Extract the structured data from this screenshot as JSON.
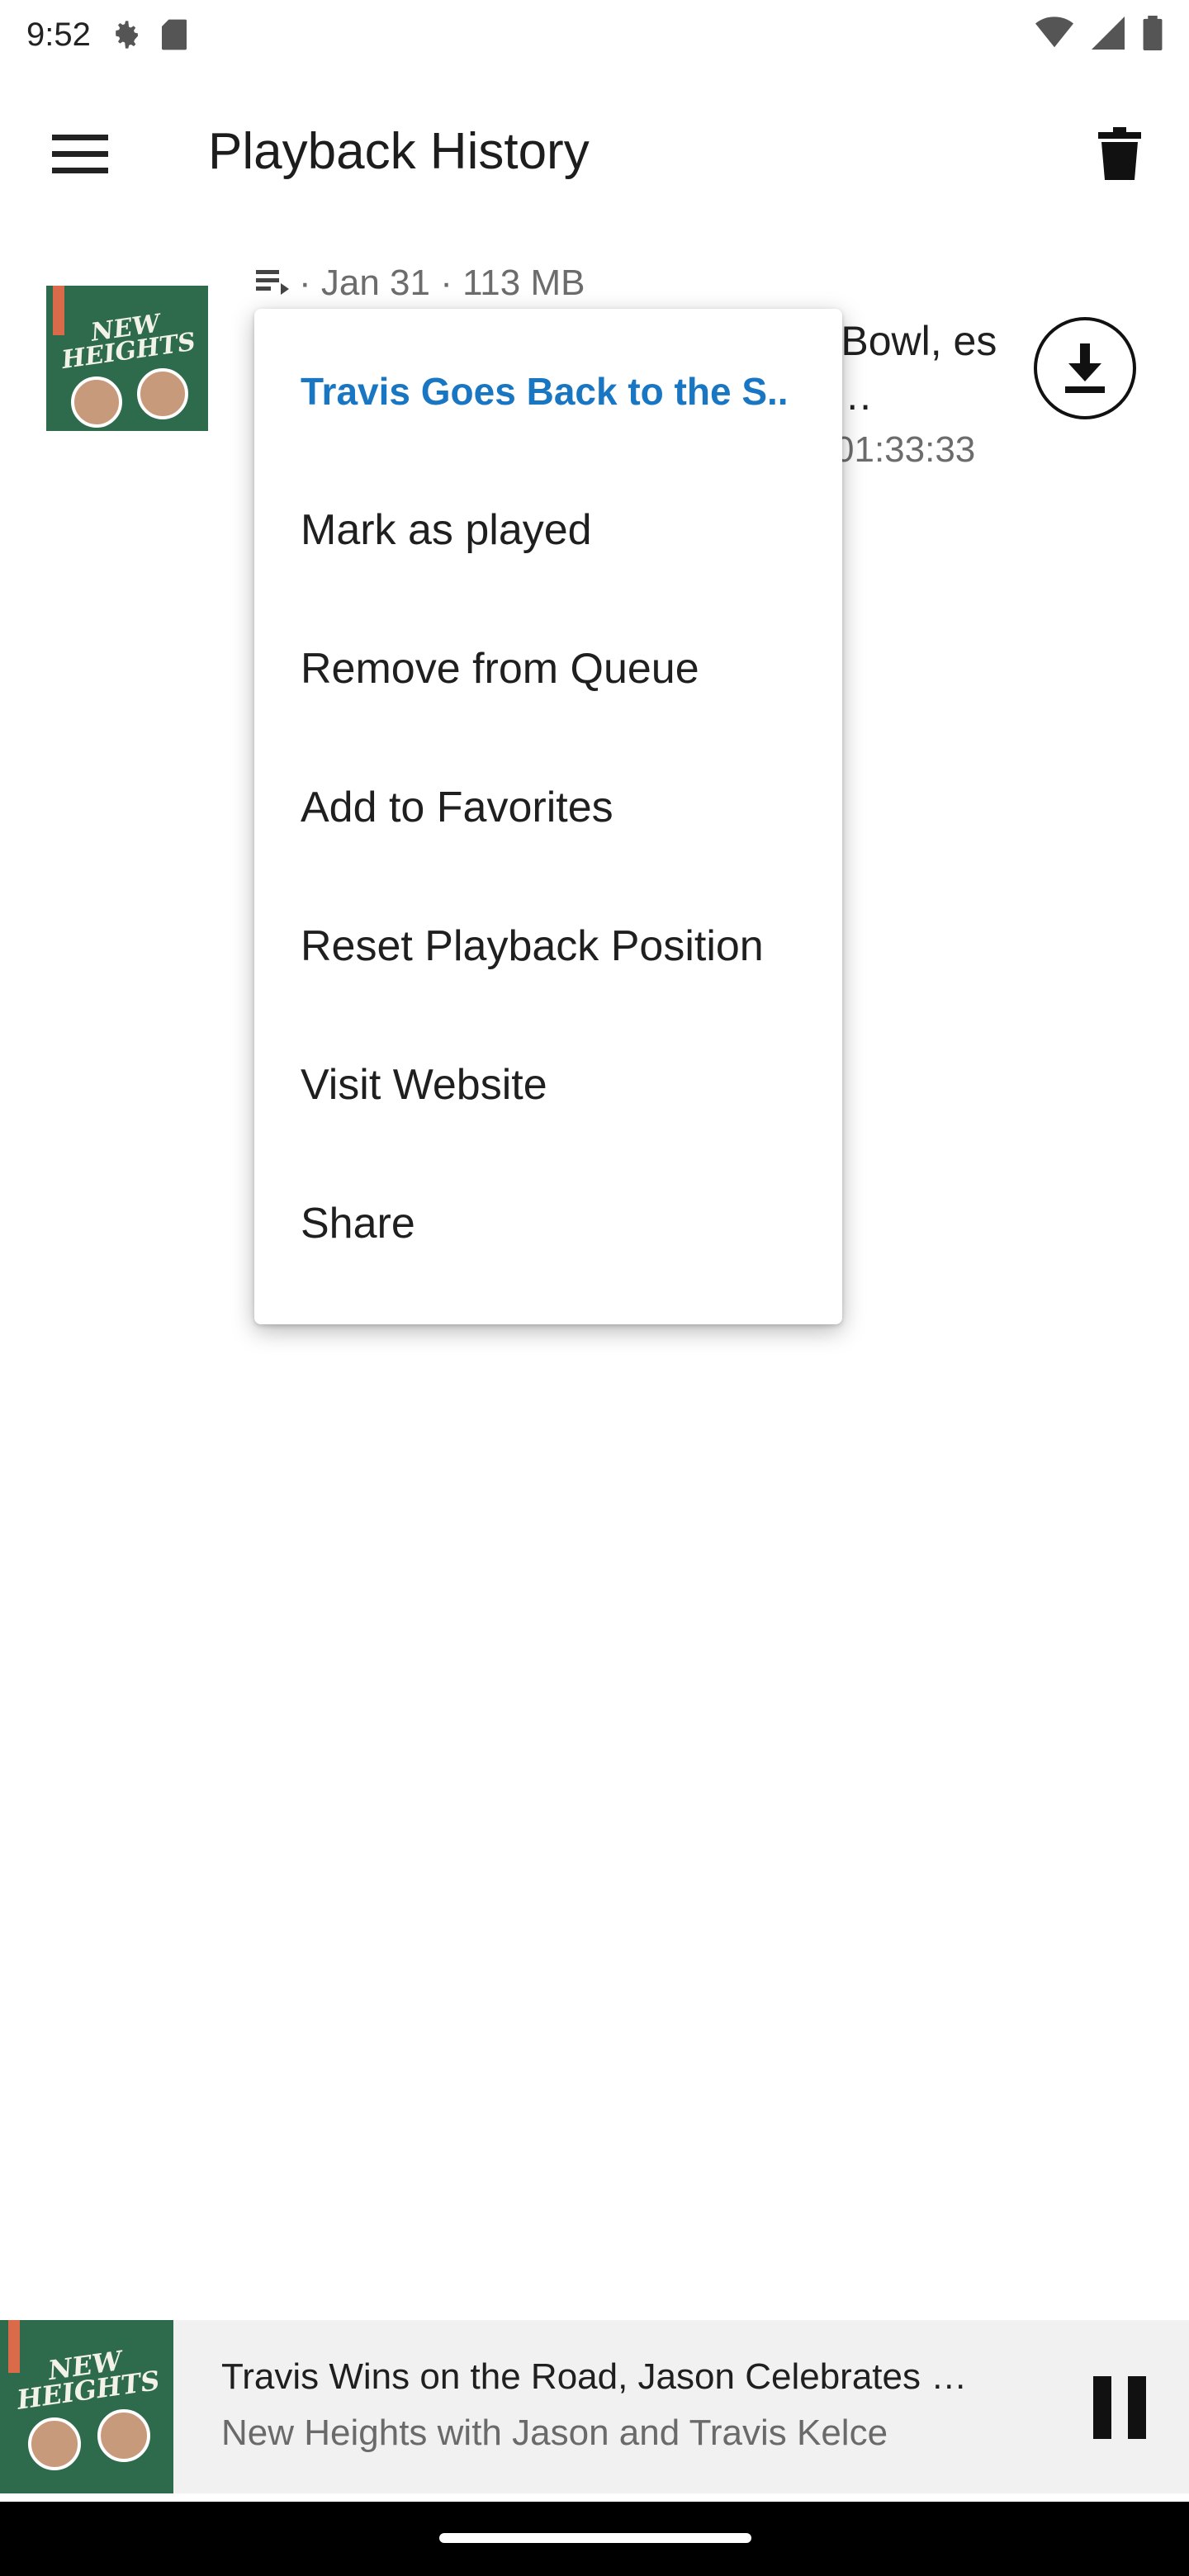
{
  "status_bar": {
    "time": "9:52",
    "icons_left": [
      "gear-icon",
      "sd-card-icon"
    ],
    "icons_right": [
      "wifi-icon",
      "signal-icon",
      "battery-icon"
    ]
  },
  "app_bar": {
    "title": "Playback History",
    "menu_icon": "hamburger-menu-icon",
    "action_icon": "trash-icon"
  },
  "episode": {
    "meta": "· Jan 31 · 113 MB",
    "title_visible": "er Bowl, es & …",
    "duration_visible": "01:33:33",
    "cover_text": "NEW HEIGHTS",
    "download_icon": "download-icon",
    "queue_icon": "queue-icon"
  },
  "popup_menu": {
    "header": "Travis Goes Back to the S..",
    "items": [
      "Mark as played",
      "Remove from Queue",
      "Add to Favorites",
      "Reset Playback Position",
      "Visit Website",
      "Share"
    ]
  },
  "mini_player": {
    "title": "Travis Wins on the Road, Jason Celebrates …",
    "subtitle": "New Heights with Jason and Travis Kelce",
    "cover_text": "NEW HEIGHTS",
    "pause_icon": "pause-icon"
  },
  "colors": {
    "accent": "#1976c2",
    "cover_green": "#2e6b4d",
    "mini_player_bg": "#f1f1f1",
    "nav_bar": "#000000"
  }
}
